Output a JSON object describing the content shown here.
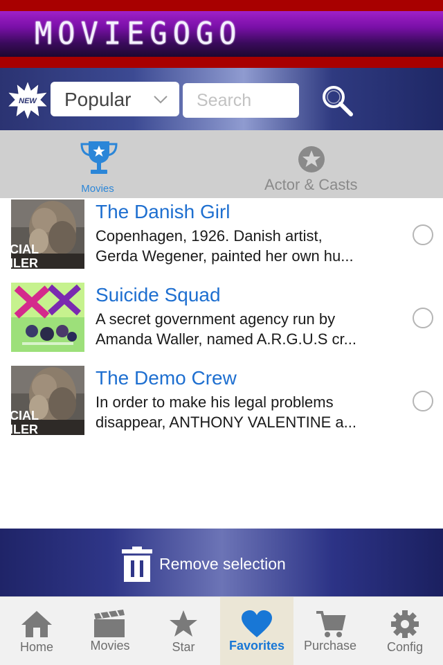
{
  "header": {
    "logo": "MOVIEGOGO"
  },
  "search": {
    "new_badge": "NEW",
    "select_value": "Popular",
    "placeholder": "Search"
  },
  "segments": [
    {
      "label": "Movies",
      "icon": "trophy-icon",
      "active": true
    },
    {
      "label": "Actor &  Casts",
      "icon": "star-circle-icon",
      "active": false
    }
  ],
  "movies": [
    {
      "title": "The Danish Girl",
      "desc_line1": "Copenhagen, 1926. Danish artist,",
      "desc_line2": "Gerda Wegener, painted her own hu...",
      "thumb_text1": "CIAL",
      "thumb_text2": "ILER"
    },
    {
      "title": "Suicide Squad",
      "desc_line1": "A secret government agency run by",
      "desc_line2": "Amanda Waller, named A.R.G.U.S cr...",
      "thumb_text1": "",
      "thumb_text2": ""
    },
    {
      "title": "The Demo Crew",
      "desc_line1": "In order to make his legal problems",
      "desc_line2": "disappear, ANTHONY VALENTINE a...",
      "thumb_text1": "CIAL",
      "thumb_text2": "ILER"
    }
  ],
  "remove_bar": {
    "label": "Remove selection"
  },
  "tabbar": [
    {
      "label": "Home",
      "icon": "home-icon"
    },
    {
      "label": "Movies",
      "icon": "clapperboard-icon"
    },
    {
      "label": "Star",
      "icon": "star-icon"
    },
    {
      "label": "Favorites",
      "icon": "heart-icon",
      "active": true
    },
    {
      "label": "Purchase",
      "icon": "cart-icon"
    },
    {
      "label": "Config",
      "icon": "gear-icon"
    }
  ],
  "colors": {
    "accent_blue": "#1e6fd0",
    "header_red": "#a80000",
    "header_purple": "#7a10a8",
    "navy": "#2b3372"
  }
}
